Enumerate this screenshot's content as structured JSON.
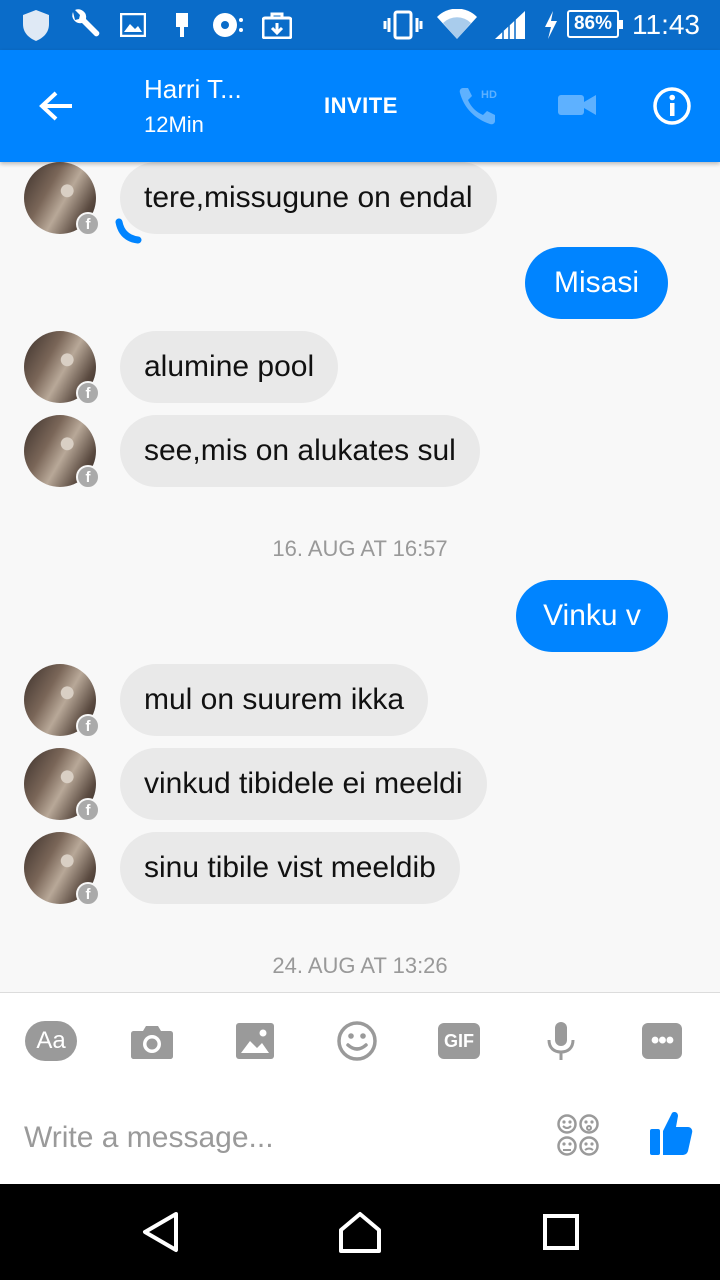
{
  "status_bar": {
    "battery": "86%",
    "time": "11:43",
    "icons": [
      "shield-icon",
      "wrench-icon",
      "image-icon",
      "usb-icon",
      "sync-icon",
      "briefcase-icon",
      "vibrate-icon",
      "wifi-icon",
      "signal-icon",
      "charging-icon"
    ]
  },
  "header": {
    "back_icon": "arrow-left-icon",
    "contact_name": "Harri T...",
    "contact_status": "12Min",
    "invite_label": "INVITE",
    "call_icon": "phone-hd-icon",
    "video_icon": "video-camera-icon",
    "info_icon": "info-icon"
  },
  "messages": [
    {
      "direction": "in",
      "text": "tere,missugune on endal"
    },
    {
      "direction": "out",
      "text": "Misasi"
    },
    {
      "direction": "in",
      "text": "alumine pool"
    },
    {
      "direction": "in",
      "text": "see,mis on alukates sul"
    },
    {
      "type": "timestamp",
      "text": "16. AUG AT 16:57"
    },
    {
      "direction": "out",
      "text": "Vinku v"
    },
    {
      "direction": "in",
      "text": "mul on suurem ikka"
    },
    {
      "direction": "in",
      "text": "vinkud tibidele ei meeldi"
    },
    {
      "direction": "in",
      "text": "sinu tibile vist meeldib"
    },
    {
      "type": "timestamp",
      "text": "24. AUG AT 13:26"
    }
  ],
  "composer": {
    "aa_label": "Aa",
    "gif_label": "GIF",
    "more_label": "•••",
    "placeholder": "Write a message...",
    "tools": [
      "text-format-icon",
      "camera-icon",
      "gallery-icon",
      "emoji-icon",
      "gif-icon",
      "microphone-icon",
      "more-icon"
    ],
    "emoji_picker_icon": "emoji-faces-icon",
    "like_icon": "thumbs-up-icon"
  },
  "colors": {
    "status_bar": "#0a6cc9",
    "header": "#0084ff",
    "outgoing_bubble": "#0084ff",
    "incoming_bubble": "#e9e9e9",
    "timestamp": "#999999"
  }
}
